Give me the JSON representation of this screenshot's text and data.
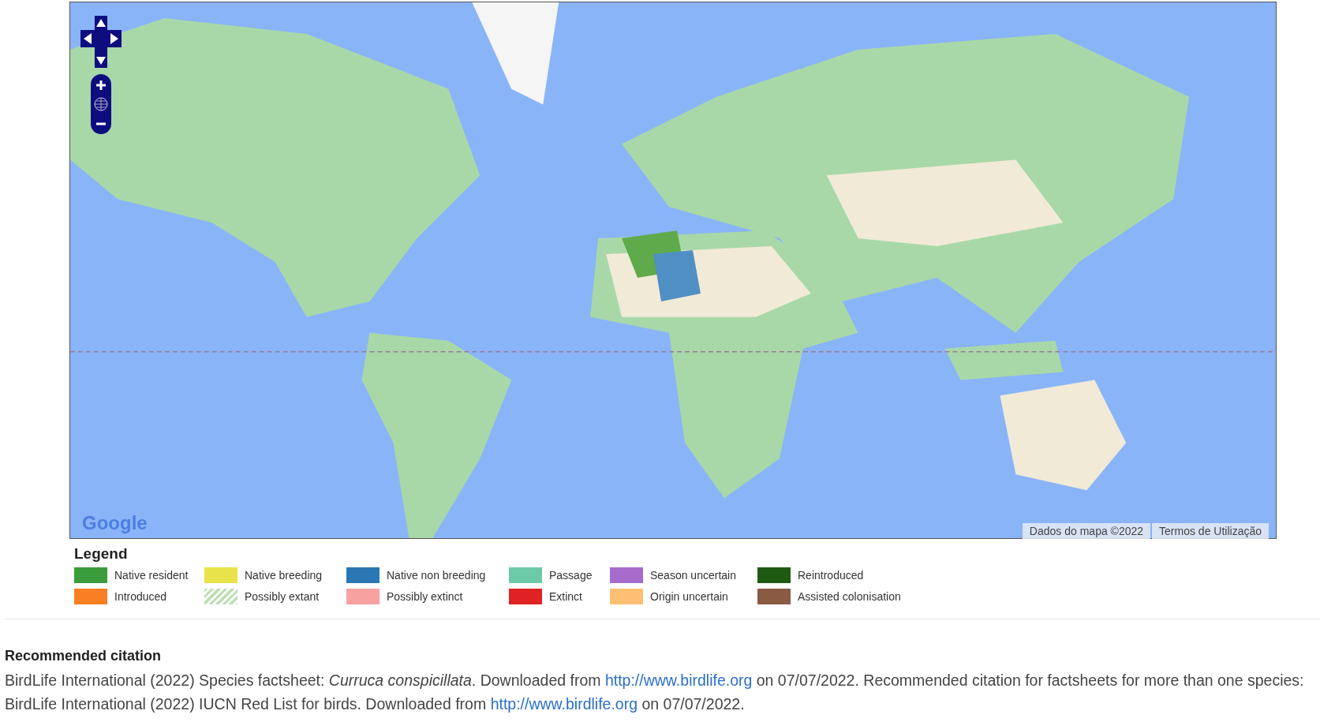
{
  "map": {
    "logo": "Google",
    "attribution": "Dados do mapa ©2022",
    "terms_link": "Termos de Utilização"
  },
  "legend": {
    "title": "Legend",
    "items": [
      {
        "label": "Native resident",
        "color": "#3a9c3a",
        "kind": "solid"
      },
      {
        "label": "Native breeding",
        "color": "#e8e34a",
        "kind": "solid"
      },
      {
        "label": "Native non breeding",
        "color": "#2a77b4",
        "kind": "solid"
      },
      {
        "label": "Passage",
        "color": "#6dcaa8",
        "kind": "solid"
      },
      {
        "label": "Season uncertain",
        "color": "#a66bcb",
        "kind": "solid"
      },
      {
        "label": "Reintroduced",
        "color": "#1f5a12",
        "kind": "solid"
      },
      {
        "label": "Introduced",
        "color": "#f97f22",
        "kind": "solid"
      },
      {
        "label": "Possibly extant",
        "color": "#b9e0b0",
        "kind": "hatched"
      },
      {
        "label": "Possibly extinct",
        "color": "#f7a1a1",
        "kind": "solid"
      },
      {
        "label": "Extinct",
        "color": "#e02222",
        "kind": "solid"
      },
      {
        "label": "Origin uncertain",
        "color": "#fdbf71",
        "kind": "solid"
      },
      {
        "label": "Assisted colonisation",
        "color": "#8a5a42",
        "kind": "solid"
      }
    ]
  },
  "citation": {
    "title": "Recommended citation",
    "parts": [
      {
        "kind": "text",
        "text": "BirdLife International (2022) Species factsheet: *Curruca conspicillata*. Downloaded from "
      },
      {
        "kind": "link",
        "text": "http://www.birdlife.org"
      },
      {
        "kind": "text",
        "text": " on 07/07/2022. Recommended citation for factsheets for more than one species: BirdLife International (2022) IUCN Red List for birds. Downloaded from "
      },
      {
        "kind": "link",
        "text": "http://www.birdlife.org"
      },
      {
        "kind": "text",
        "text": " on 07/07/2022."
      }
    ]
  }
}
